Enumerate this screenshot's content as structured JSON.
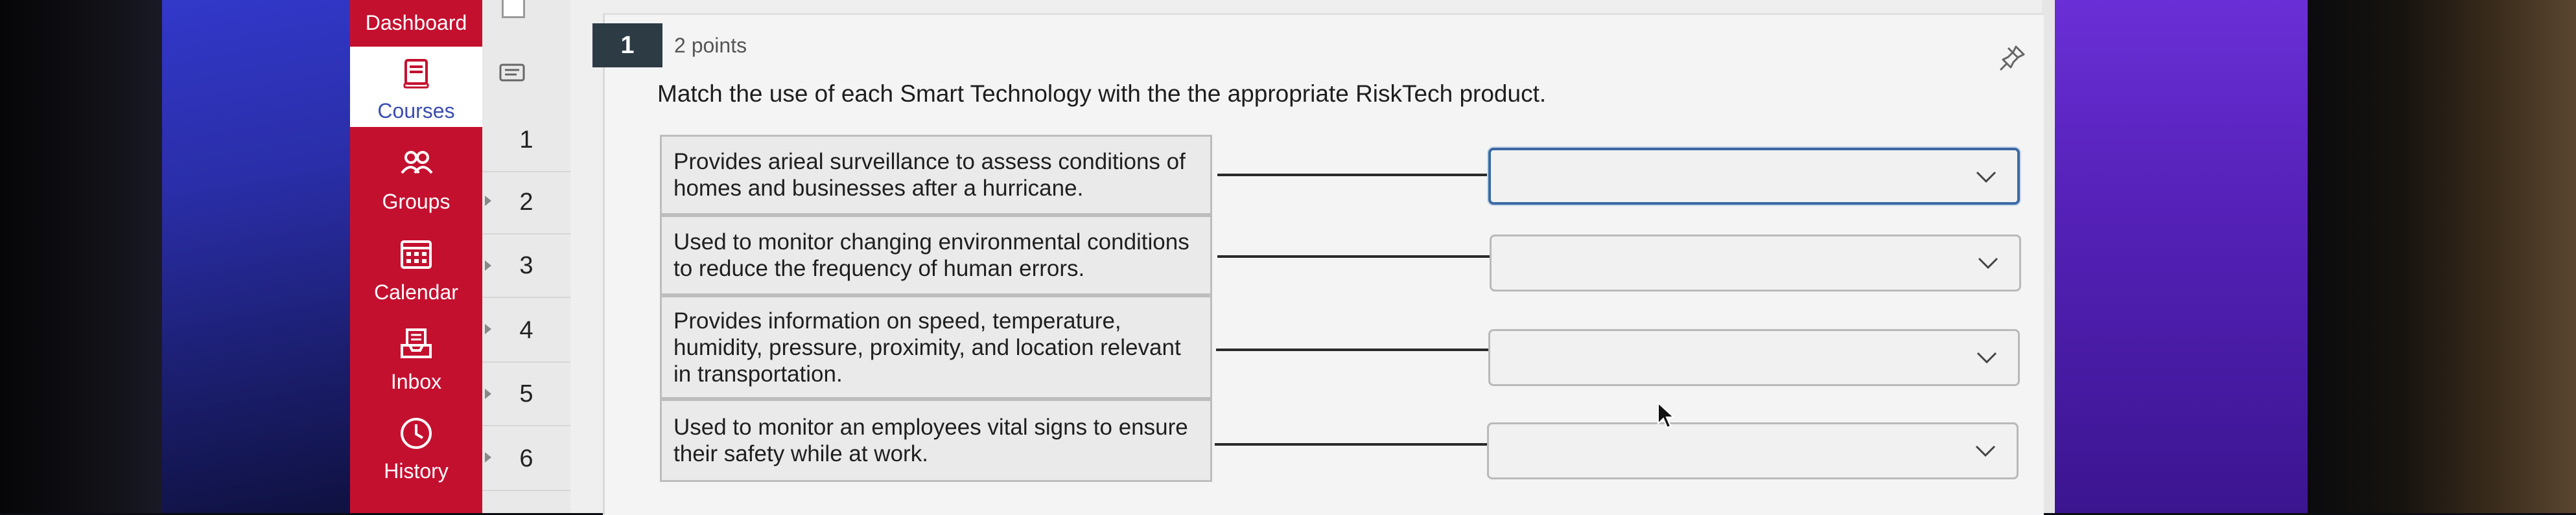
{
  "global_nav": {
    "dashboard_label": "Dashboard",
    "items": [
      {
        "label": "Courses",
        "icon": "courses-icon",
        "active": true
      },
      {
        "label": "Groups",
        "icon": "groups-icon"
      },
      {
        "label": "Calendar",
        "icon": "calendar-icon"
      },
      {
        "label": "Inbox",
        "icon": "inbox-icon"
      },
      {
        "label": "History",
        "icon": "history-icon"
      }
    ]
  },
  "question_nav": {
    "numbers": [
      "1",
      "2",
      "3",
      "4",
      "5",
      "6"
    ]
  },
  "question": {
    "number": "1",
    "points": "2 points",
    "text": "Match the use of each Smart Technology with the the appropriate RiskTech product.",
    "prompts": [
      "Provides arieal surveillance to assess conditions of homes and businesses after a hurricane.",
      "Used to monitor changing environmental conditions to reduce the frequency of human errors.",
      "Provides information on speed, temperature, humidity, pressure, proximity, and location relevant in transportation.",
      "Used to monitor an employees vital signs to ensure their safety while at work."
    ],
    "answers": [
      "",
      "",
      "",
      ""
    ]
  },
  "colors": {
    "nav_red": "#c4102f",
    "question_badge": "#2d3b45",
    "focus_blue": "#3b6aa3"
  }
}
